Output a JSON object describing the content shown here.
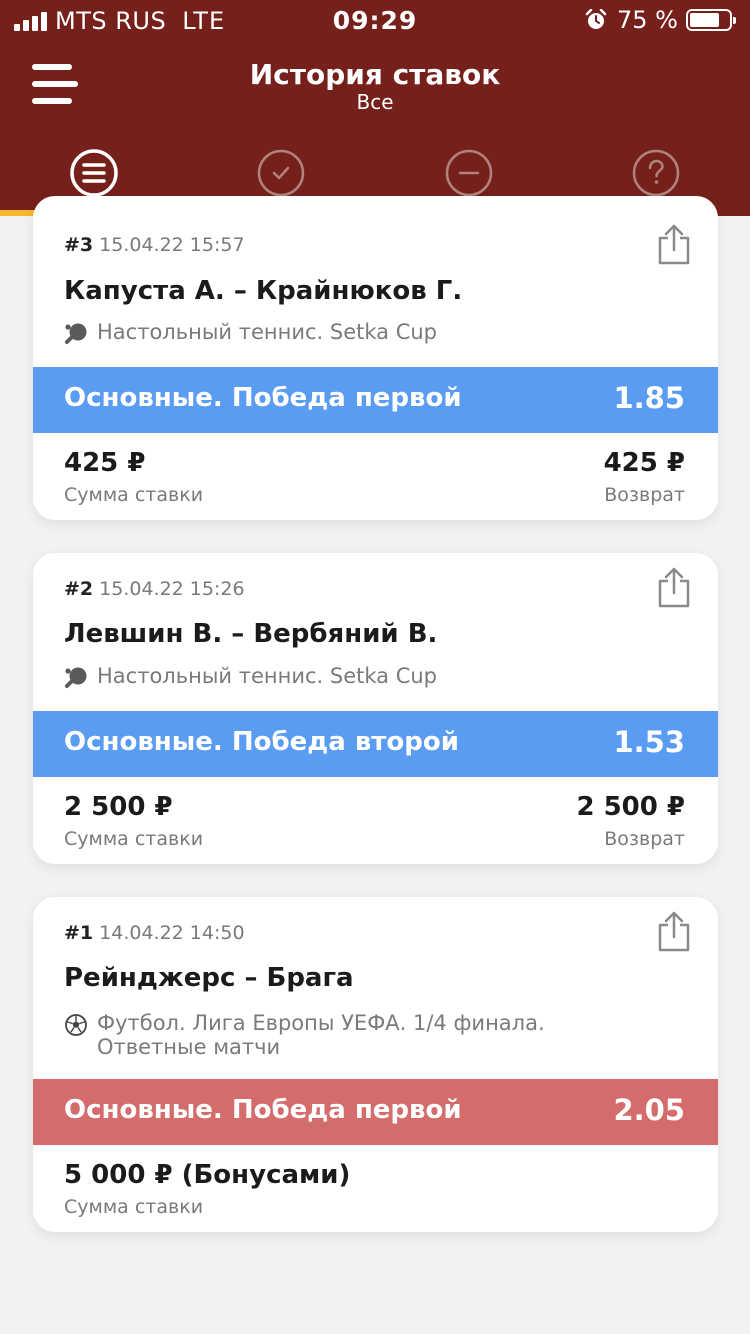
{
  "status_bar": {
    "carrier": "MTS RUS",
    "network": "LTE",
    "time": "09:29",
    "battery": "75 %",
    "battery_level": 0.75
  },
  "header": {
    "title": "История ставок",
    "subtitle": "Все",
    "menu_icon": "hamburger-icon",
    "tabs": [
      {
        "icon": "list-icon",
        "active": true
      },
      {
        "icon": "check-icon",
        "active": false
      },
      {
        "icon": "minus-icon",
        "active": false
      },
      {
        "icon": "question-icon",
        "active": false
      }
    ]
  },
  "colors": {
    "header_bg": "#76201b",
    "tab_indicator": "#f5b92e",
    "bet_blue": "#5b9cf3",
    "bet_red": "#d46c6c"
  },
  "bets": [
    {
      "number": "#3",
      "datetime": "15.04.22 15:57",
      "match": "Капуста А. – Крайнюков Г.",
      "league": "Настольный теннис. Setka Cup",
      "sport_icon": "table-tennis-icon",
      "market": "Основные. Победа первой",
      "odds": "1.85",
      "status_color": "#5b9cf3",
      "stake": "425 ₽",
      "stake_label": "Сумма ставки",
      "payout": "425 ₽",
      "payout_label": "Возврат"
    },
    {
      "number": "#2",
      "datetime": "15.04.22 15:26",
      "match": "Левшин В. – Вербяний В.",
      "league": "Настольный теннис. Setka Cup",
      "sport_icon": "table-tennis-icon",
      "market": "Основные. Победа второй",
      "odds": "1.53",
      "status_color": "#5b9cf3",
      "stake": "2 500 ₽",
      "stake_label": "Сумма ставки",
      "payout": "2 500 ₽",
      "payout_label": "Возврат"
    },
    {
      "number": "#1",
      "datetime": "14.04.22 14:50",
      "match": "Рейнджерс – Брага",
      "league_line1": "Футбол. Лига Европы УЕФА. 1/4 финала.",
      "league_line2": "Ответные матчи",
      "sport_icon": "soccer-ball-icon",
      "market": "Основные. Победа первой",
      "odds": "2.05",
      "status_color": "#d46c6c",
      "stake": "5 000 ₽ (Бонусами)",
      "stake_label": "Сумма ставки"
    }
  ]
}
